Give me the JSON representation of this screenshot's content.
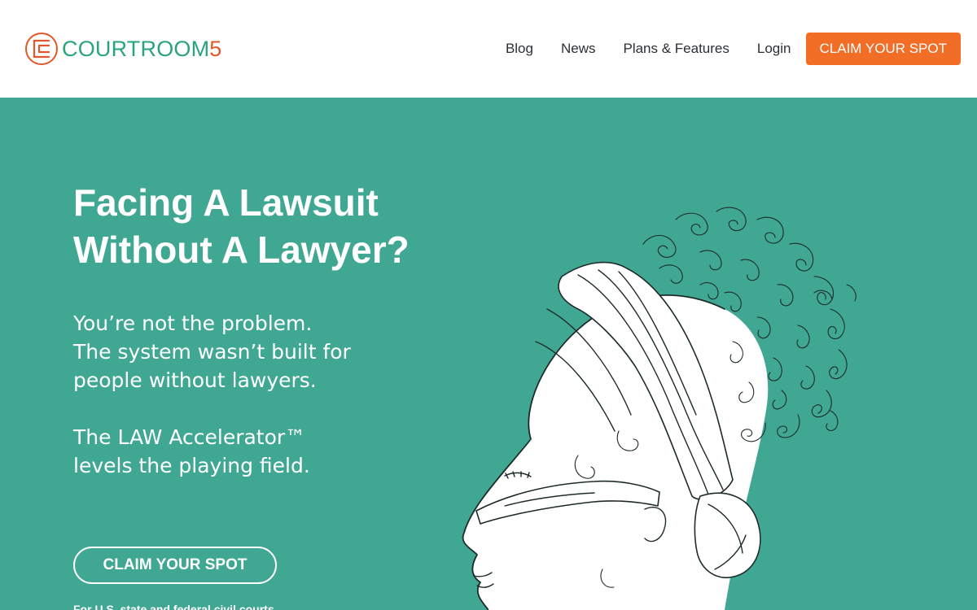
{
  "header": {
    "logo": {
      "brand": "COURTROOM",
      "number": "5",
      "colors": {
        "brand": "#2aa37f",
        "accent": "#e2572a"
      }
    },
    "nav": [
      "Blog",
      "News",
      "Plans & Features",
      "Login"
    ],
    "cta_label": "CLAIM YOUR SPOT"
  },
  "hero": {
    "background": "#3fa792",
    "headline_lines": [
      "Facing A Lawsuit",
      "Without A Lawyer?"
    ],
    "subtext_1": [
      "You’re not the problem.",
      "The system wasn’t built for",
      "people without lawyers."
    ],
    "subtext_2": [
      "The LAW Accelerator™",
      "levels the playing field."
    ],
    "cta_label": "CLAIM YOUR SPOT",
    "footnote": "For U.S. state and federal civil courts",
    "illustration": "blindfolded-woman-line-drawing"
  }
}
